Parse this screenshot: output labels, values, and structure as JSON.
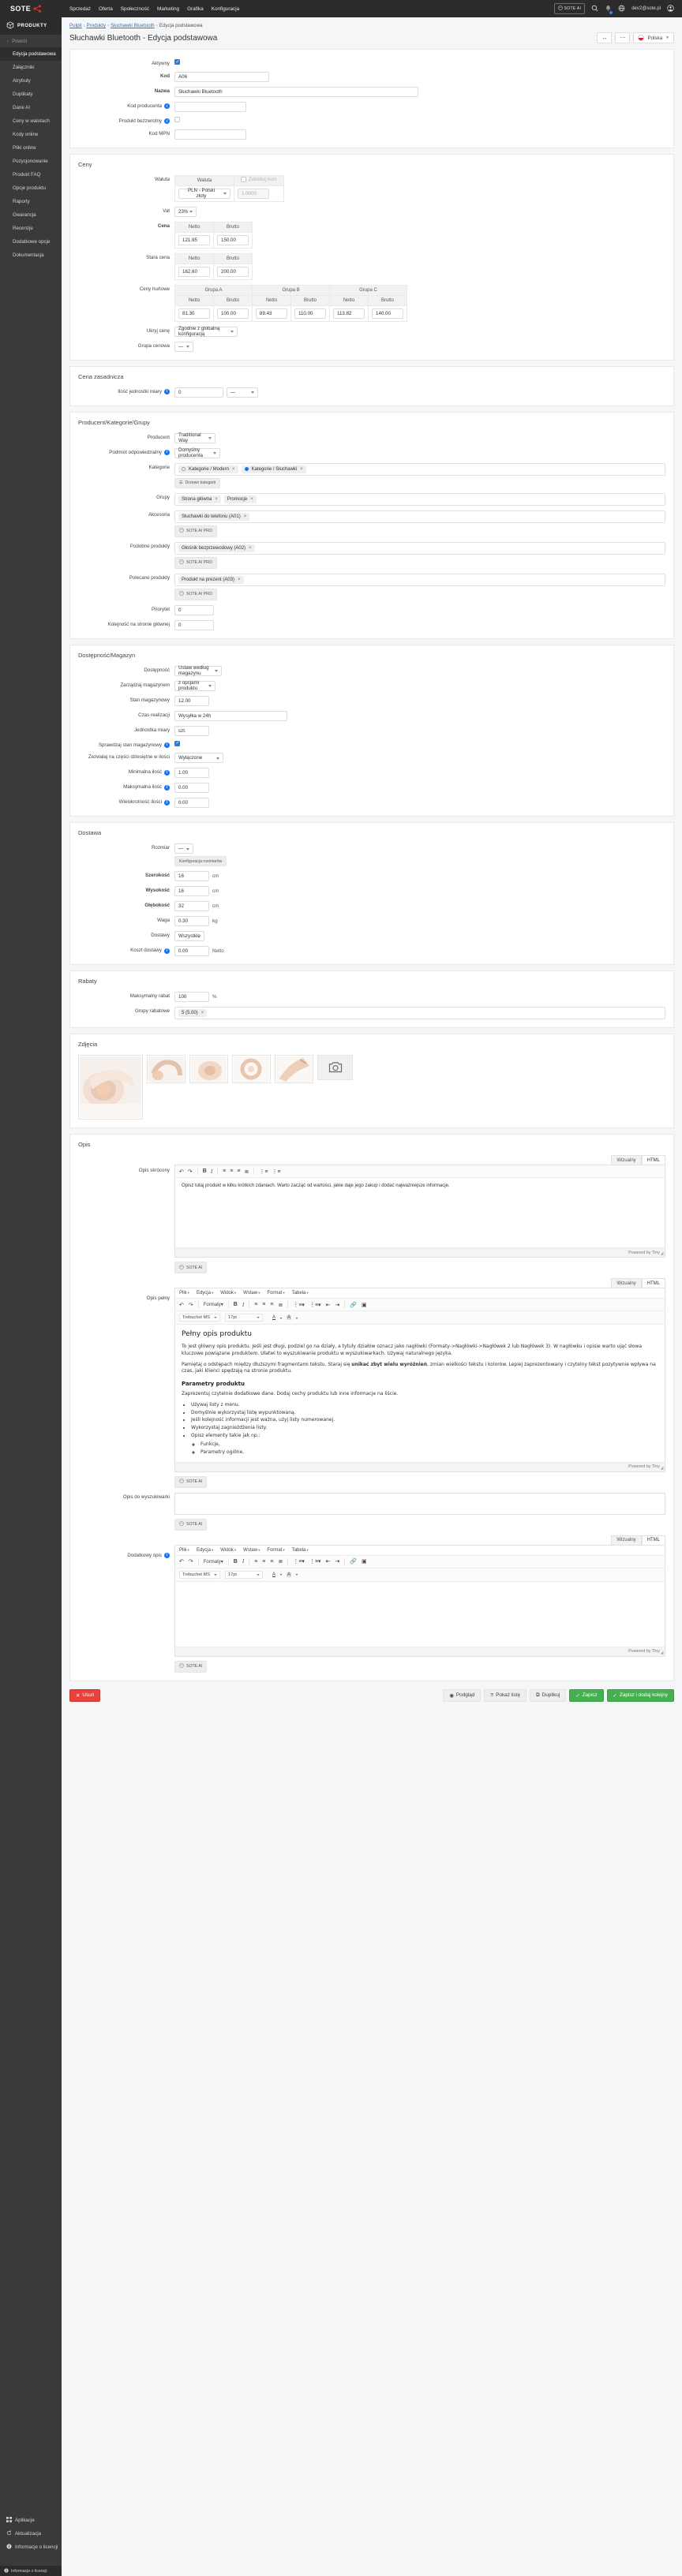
{
  "topbar": {
    "brand": "SOTE",
    "nav": [
      "Sprzedaż",
      "Oferta",
      "Społeczność",
      "Marketing",
      "Grafika",
      "Konfiguracja"
    ],
    "ai_button": "SOTE AI",
    "user_email": "dev2@sote.pl"
  },
  "sidebar": {
    "section": "PRODUKTY",
    "back": "Powrót",
    "items": [
      "Edycja podstawowa",
      "Załączniki",
      "Atrybuty",
      "Duplikaty",
      "Dane AI",
      "Ceny w walutach",
      "Kody online",
      "Pliki online",
      "Pozycjonowanie",
      "Produkt FAQ",
      "Opcje produktu",
      "Raporty",
      "Gwarancja",
      "Recenzje",
      "Dodatkowe opcje",
      "Dokumentacja"
    ],
    "active_index": 0,
    "bottom": [
      "Aplikacje",
      "Aktualizacja",
      "Informacje o licencji"
    ],
    "status": "Informacje o licencji"
  },
  "breadcrumb": {
    "items": [
      "Pulpit",
      "Produkty",
      "Słuchawki Bluetooth",
      "Edycja podstawowa"
    ]
  },
  "page": {
    "title": "Słuchawki Bluetooth - Edycja podstawowa",
    "language": "Polska"
  },
  "basic": {
    "aktywny_label": "Aktywny",
    "aktywny_checked": true,
    "kod_label": "Kod",
    "kod_value": "A06",
    "nazwa_label": "Nazwa",
    "nazwa_value": "Słuchawki Bluetooth",
    "kod_producenta_label": "Kod producenta",
    "kod_producenta_value": "",
    "produkt_bezzwrotny_label": "Produkt bezzwrotny",
    "produkt_bezzwrotny_checked": false,
    "kod_mpn_label": "Kod MPN",
    "kod_mpn_value": ""
  },
  "ceny": {
    "title": "Ceny",
    "waluta_label": "Waluta",
    "waluta_header": "Waluta",
    "zablokuj_kurs_label": "Zablokuj kurs",
    "zablokuj_kurs_checked": false,
    "waluta_value": "PLN - Polski złoty",
    "kurs_value": "1.0000",
    "vat_label": "Vat",
    "vat_value": "23%",
    "netto": "Netto",
    "brutto": "Brutto",
    "cena_label": "Cena",
    "cena_netto": "121.95",
    "cena_brutto": "150.00",
    "stara_cena_label": "Stara cena",
    "stara_netto": "162.60",
    "stara_brutto": "200.00",
    "ceny_hurtowe_label": "Ceny hurtowe",
    "grupy": [
      "Grupa A",
      "Grupa B",
      "Grupa C"
    ],
    "hurtowe": [
      {
        "netto": "81.30",
        "brutto": "100.00"
      },
      {
        "netto": "89.43",
        "brutto": "110.00"
      },
      {
        "netto": "113.82",
        "brutto": "140.00"
      }
    ],
    "ukryj_cene_label": "Ukryj cenę",
    "ukryj_cene_value": "Zgodnie z globalną konfiguracją",
    "grupa_cenowa_label": "Grupa cenowa",
    "grupa_cenowa_value": "—"
  },
  "cena_zasadnicza": {
    "title": "Cena zasadnicza",
    "ilosc_label": "Ilość jednostki miary",
    "ilosc_value": "0",
    "jednostka_value": "—"
  },
  "producent": {
    "title": "Producent/Kategorie/Grupy",
    "producent_label": "Producent",
    "producent_value": "Traditional Way",
    "podmiot_label": "Podmiot odpowiedzialny",
    "podmiot_value": "Domyślny producenta",
    "kategorie_label": "Kategorie",
    "kategorie": [
      {
        "text": "Kategorie / Modern",
        "selected": false
      },
      {
        "text": "Kategorie / Słuchawki",
        "selected": true
      }
    ],
    "drzewo_btn": "Drzewo kategorii",
    "grupy_label": "Grupy",
    "grupy": [
      "Strona główna",
      "Promocje"
    ],
    "akcesoria_label": "Akcesoria",
    "akcesoria": [
      "Słuchawki do telefonu (A01)"
    ],
    "podobne_label": "Podobne produkty",
    "podobne": [
      "Głośnik bezprzewodowy (A02)"
    ],
    "polecane_label": "Polecane produkty",
    "polecane": [
      "Produkt na prezent (A03)"
    ],
    "ai_pro_btn": "SOTE AI PRO",
    "priorytet_label": "Priorytet",
    "priorytet_value": "0",
    "kolejnosc_label": "Kolejność na stronie głównej",
    "kolejnosc_value": "0"
  },
  "magazyn": {
    "title": "Dostępność/Magazyn",
    "dostepnosc_label": "Dostępność",
    "dostepnosc_value": "Ustaw według magazynu",
    "zarzadzaj_label": "Zarządzaj magazynem",
    "zarzadzaj_value": "z opcjami produktu",
    "stan_label": "Stan magazynowy",
    "stan_value": "12.00",
    "czas_label": "Czas realizacji",
    "czas_value": "Wysyłka w 24h",
    "jednostka_label": "Jednostka miary",
    "jednostka_value": "szt.",
    "sprawdzaj_label": "Sprawdzaj stan magazynowy",
    "sprawdzaj_checked": true,
    "dziesietne_label": "Zezwalaj na części dziesiętne w ilości",
    "dziesietne_value": "Wyłączone",
    "min_label": "Minimalna ilość",
    "min_value": "1.00",
    "max_label": "Maksymalna ilość",
    "max_value": "0.00",
    "wielokrotnosc_label": "Wielokrotność ilości",
    "wielokrotnosc_value": "0.00"
  },
  "dostawa": {
    "title": "Dostawa",
    "rozmiar_label": "Rozmiar",
    "rozmiar_value": "—",
    "konfiguracja_btn": "Konfiguracja rozmiarów",
    "szerokosc_label": "Szerokość",
    "szerokosc_value": "16",
    "wysokosc_label": "Wysokość",
    "wysokosc_value": "16",
    "glebokosc_label": "Głębokość",
    "glebokosc_value": "32",
    "waga_label": "Waga",
    "waga_value": "0.30",
    "cm": "cm",
    "kg": "kg",
    "dostawy_label": "Dostawy",
    "dostawy_value": "Wszystkie",
    "koszt_label": "Koszt dostawy",
    "koszt_value": "0.00",
    "koszt_unit": "Netto"
  },
  "rabaty": {
    "title": "Rabaty",
    "max_label": "Maksymalny rabat",
    "max_value": "100",
    "percent": "%",
    "grupy_label": "Grupy rabatowe",
    "grupy": [
      "5 (5.00)"
    ]
  },
  "zdjecia": {
    "title": "Zdjęcia",
    "add_icon": "camera-icon",
    "count": 5
  },
  "opis": {
    "title": "Opis",
    "tab_visual": "Wizualny",
    "tab_html": "HTML",
    "skrocony_label": "Opis skrócony",
    "skrocony_text": "Opisz tutaj produkt w kilku krótkich zdaniach. Warto zacząć od wartości, jakie daje jego zakup i dodać najważniejsze informacje.",
    "pelny_label": "Opis pełny",
    "wyszukiwarka_label": "Opis do wyszukiwarki",
    "wyszukiwarka_text": "",
    "dodatkowy_label": "Dodatkowy opis",
    "dodatkowy_text": "",
    "menubar": [
      "Plik",
      "Edycja",
      "Widok",
      "Wstaw",
      "Format",
      "Tabela"
    ],
    "formaty_label": "Formaty",
    "font_family": "Trebuchet MS",
    "font_size": "17pt",
    "powered": "Powered by Tiny",
    "sote_ai_btn": "SOTE AI",
    "pelny_content": {
      "heading": "Pełny opis produktu",
      "p1": "To jest główny opis produktu. Jeśli jest długi, podziel go na działy, a tytuły działów oznacz jako nagłówki (Formaty->Nagłówki->Nagłówek 2 lub Nagłówek 3). W nagłówku i opisie warto ująć słowa kluczowe powiązane produktem. Ułatwi to wyszukiwanie produktu w wyszukiwarkach. Używaj naturalnego języka.",
      "p2_a": "Pamiętaj o odstępach między dłuższymi fragmentami tekstu. Staraj się ",
      "p2_b": "unikać zbyt wielu wyróżnień",
      "p2_c": ", zmian wielkości tekstu i kolorów. Lepiej zaprezentowany i czytelny tekst pozytywnie wpływa na czas, jaki klienci spędzają na stronie produktu.",
      "heading2": "Parametry produktu",
      "p3": "Zaprezentuj czytelnie dodatkowe dane. Dodaj cechy produktu lub inne informacje na liście.",
      "bullets": [
        "Używaj listy z menu.",
        "Domyślnie wykorzystaj listę wypunktowaną.",
        "Jeśli kolejność informacji jest ważna, użyj listy numerowanej.",
        "Wykorzystaj zagnieżdżenia listy.",
        "Opisz elementy takie jak np.:"
      ],
      "subbullets": [
        "Funkcje,",
        "Parametry ogólne,"
      ]
    }
  },
  "footer": {
    "delete": "Usuń",
    "preview": "Podgląd",
    "show_list": "Pokaż listę",
    "duplicate": "Duplikuj",
    "save": "Zapisz",
    "save_add": "Zapisz i dodaj kolejny"
  }
}
